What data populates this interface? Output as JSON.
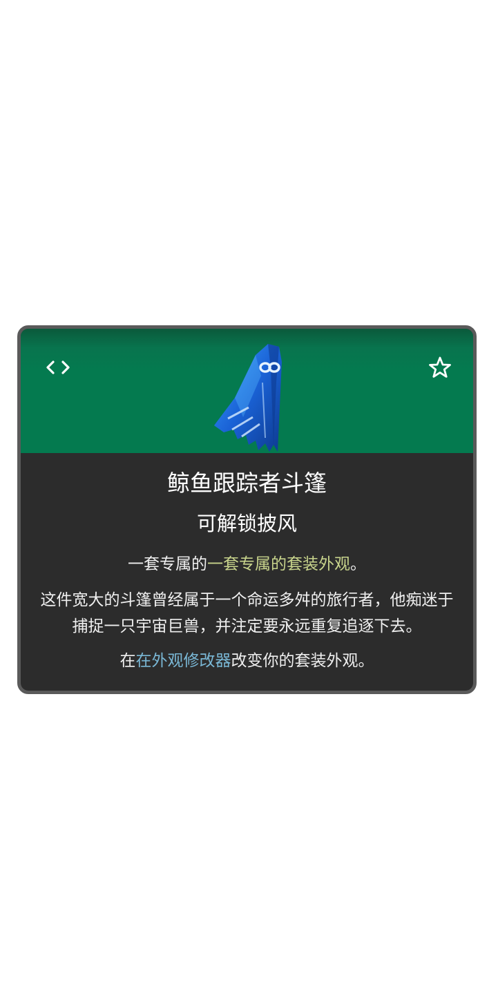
{
  "card": {
    "icons": {
      "left": "code-brackets-icon",
      "right": "star-outline-icon",
      "item": "cloak-image"
    },
    "colors": {
      "header": "#047a4f",
      "body": "#2c2c2c",
      "border": "#5a5a5a",
      "highlight_green": "#c8d48c",
      "link_blue": "#7ab8d6"
    },
    "title": "鲸鱼跟踪者斗篷",
    "subtitle": "可解锁披风",
    "set_line": {
      "prefix": "一套专属的",
      "highlight": "一套专属的套装外观",
      "suffix": "。"
    },
    "description": "这件宽大的斗篷曾经属于一个命运多舛的旅行者，他痴迷于捕捉一只宇宙巨兽，并注定要永远重复追逐下去。",
    "modifier_line": {
      "prefix": "在",
      "link": "在外观修改器",
      "suffix": "改变你的套装外观。"
    }
  }
}
